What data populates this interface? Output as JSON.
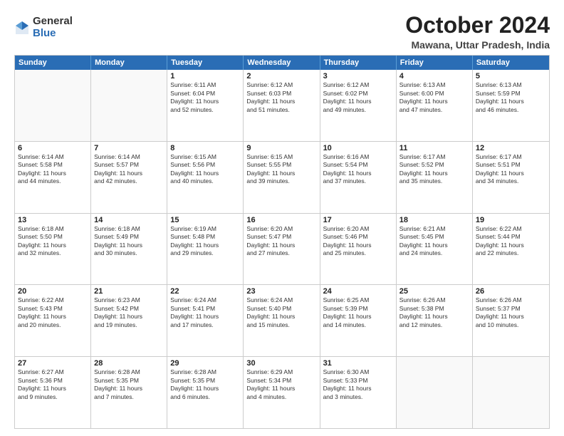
{
  "logo": {
    "general": "General",
    "blue": "Blue"
  },
  "title": "October 2024",
  "location": "Mawana, Uttar Pradesh, India",
  "days": [
    "Sunday",
    "Monday",
    "Tuesday",
    "Wednesday",
    "Thursday",
    "Friday",
    "Saturday"
  ],
  "rows": [
    [
      {
        "num": "",
        "lines": []
      },
      {
        "num": "",
        "lines": []
      },
      {
        "num": "1",
        "lines": [
          "Sunrise: 6:11 AM",
          "Sunset: 6:04 PM",
          "Daylight: 11 hours",
          "and 52 minutes."
        ]
      },
      {
        "num": "2",
        "lines": [
          "Sunrise: 6:12 AM",
          "Sunset: 6:03 PM",
          "Daylight: 11 hours",
          "and 51 minutes."
        ]
      },
      {
        "num": "3",
        "lines": [
          "Sunrise: 6:12 AM",
          "Sunset: 6:02 PM",
          "Daylight: 11 hours",
          "and 49 minutes."
        ]
      },
      {
        "num": "4",
        "lines": [
          "Sunrise: 6:13 AM",
          "Sunset: 6:00 PM",
          "Daylight: 11 hours",
          "and 47 minutes."
        ]
      },
      {
        "num": "5",
        "lines": [
          "Sunrise: 6:13 AM",
          "Sunset: 5:59 PM",
          "Daylight: 11 hours",
          "and 46 minutes."
        ]
      }
    ],
    [
      {
        "num": "6",
        "lines": [
          "Sunrise: 6:14 AM",
          "Sunset: 5:58 PM",
          "Daylight: 11 hours",
          "and 44 minutes."
        ]
      },
      {
        "num": "7",
        "lines": [
          "Sunrise: 6:14 AM",
          "Sunset: 5:57 PM",
          "Daylight: 11 hours",
          "and 42 minutes."
        ]
      },
      {
        "num": "8",
        "lines": [
          "Sunrise: 6:15 AM",
          "Sunset: 5:56 PM",
          "Daylight: 11 hours",
          "and 40 minutes."
        ]
      },
      {
        "num": "9",
        "lines": [
          "Sunrise: 6:15 AM",
          "Sunset: 5:55 PM",
          "Daylight: 11 hours",
          "and 39 minutes."
        ]
      },
      {
        "num": "10",
        "lines": [
          "Sunrise: 6:16 AM",
          "Sunset: 5:54 PM",
          "Daylight: 11 hours",
          "and 37 minutes."
        ]
      },
      {
        "num": "11",
        "lines": [
          "Sunrise: 6:17 AM",
          "Sunset: 5:52 PM",
          "Daylight: 11 hours",
          "and 35 minutes."
        ]
      },
      {
        "num": "12",
        "lines": [
          "Sunrise: 6:17 AM",
          "Sunset: 5:51 PM",
          "Daylight: 11 hours",
          "and 34 minutes."
        ]
      }
    ],
    [
      {
        "num": "13",
        "lines": [
          "Sunrise: 6:18 AM",
          "Sunset: 5:50 PM",
          "Daylight: 11 hours",
          "and 32 minutes."
        ]
      },
      {
        "num": "14",
        "lines": [
          "Sunrise: 6:18 AM",
          "Sunset: 5:49 PM",
          "Daylight: 11 hours",
          "and 30 minutes."
        ]
      },
      {
        "num": "15",
        "lines": [
          "Sunrise: 6:19 AM",
          "Sunset: 5:48 PM",
          "Daylight: 11 hours",
          "and 29 minutes."
        ]
      },
      {
        "num": "16",
        "lines": [
          "Sunrise: 6:20 AM",
          "Sunset: 5:47 PM",
          "Daylight: 11 hours",
          "and 27 minutes."
        ]
      },
      {
        "num": "17",
        "lines": [
          "Sunrise: 6:20 AM",
          "Sunset: 5:46 PM",
          "Daylight: 11 hours",
          "and 25 minutes."
        ]
      },
      {
        "num": "18",
        "lines": [
          "Sunrise: 6:21 AM",
          "Sunset: 5:45 PM",
          "Daylight: 11 hours",
          "and 24 minutes."
        ]
      },
      {
        "num": "19",
        "lines": [
          "Sunrise: 6:22 AM",
          "Sunset: 5:44 PM",
          "Daylight: 11 hours",
          "and 22 minutes."
        ]
      }
    ],
    [
      {
        "num": "20",
        "lines": [
          "Sunrise: 6:22 AM",
          "Sunset: 5:43 PM",
          "Daylight: 11 hours",
          "and 20 minutes."
        ]
      },
      {
        "num": "21",
        "lines": [
          "Sunrise: 6:23 AM",
          "Sunset: 5:42 PM",
          "Daylight: 11 hours",
          "and 19 minutes."
        ]
      },
      {
        "num": "22",
        "lines": [
          "Sunrise: 6:24 AM",
          "Sunset: 5:41 PM",
          "Daylight: 11 hours",
          "and 17 minutes."
        ]
      },
      {
        "num": "23",
        "lines": [
          "Sunrise: 6:24 AM",
          "Sunset: 5:40 PM",
          "Daylight: 11 hours",
          "and 15 minutes."
        ]
      },
      {
        "num": "24",
        "lines": [
          "Sunrise: 6:25 AM",
          "Sunset: 5:39 PM",
          "Daylight: 11 hours",
          "and 14 minutes."
        ]
      },
      {
        "num": "25",
        "lines": [
          "Sunrise: 6:26 AM",
          "Sunset: 5:38 PM",
          "Daylight: 11 hours",
          "and 12 minutes."
        ]
      },
      {
        "num": "26",
        "lines": [
          "Sunrise: 6:26 AM",
          "Sunset: 5:37 PM",
          "Daylight: 11 hours",
          "and 10 minutes."
        ]
      }
    ],
    [
      {
        "num": "27",
        "lines": [
          "Sunrise: 6:27 AM",
          "Sunset: 5:36 PM",
          "Daylight: 11 hours",
          "and 9 minutes."
        ]
      },
      {
        "num": "28",
        "lines": [
          "Sunrise: 6:28 AM",
          "Sunset: 5:35 PM",
          "Daylight: 11 hours",
          "and 7 minutes."
        ]
      },
      {
        "num": "29",
        "lines": [
          "Sunrise: 6:28 AM",
          "Sunset: 5:35 PM",
          "Daylight: 11 hours",
          "and 6 minutes."
        ]
      },
      {
        "num": "30",
        "lines": [
          "Sunrise: 6:29 AM",
          "Sunset: 5:34 PM",
          "Daylight: 11 hours",
          "and 4 minutes."
        ]
      },
      {
        "num": "31",
        "lines": [
          "Sunrise: 6:30 AM",
          "Sunset: 5:33 PM",
          "Daylight: 11 hours",
          "and 3 minutes."
        ]
      },
      {
        "num": "",
        "lines": []
      },
      {
        "num": "",
        "lines": []
      }
    ]
  ]
}
